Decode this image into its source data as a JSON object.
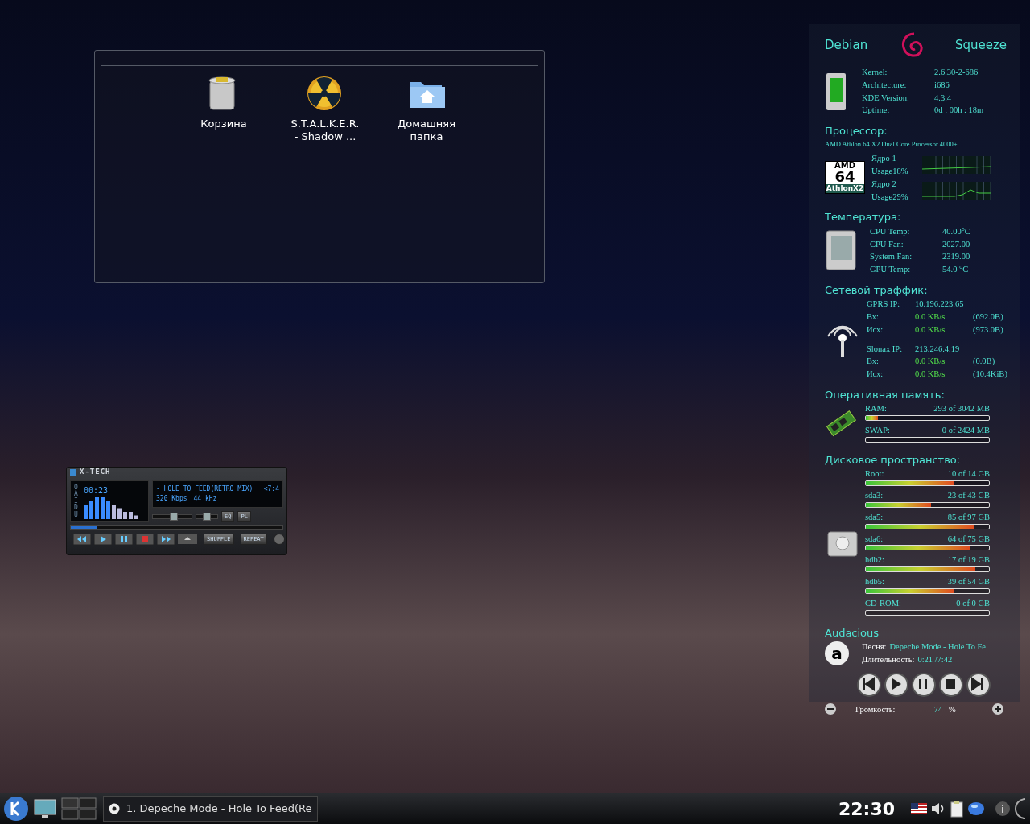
{
  "desktop": {
    "folder_view": {
      "icons": [
        {
          "label": "Корзина",
          "kind": "trash"
        },
        {
          "label": "S.T.A.L.K.E.R.\n- Shadow ...",
          "kind": "radiation"
        },
        {
          "label": "Домашняя\nпапка",
          "kind": "home"
        }
      ]
    }
  },
  "player": {
    "title": "X-TECH",
    "side_label": "OAIDU",
    "time": "00:23",
    "track": "- HOLE TO FEED(RETRO MIX)",
    "track_tail": "<7:4",
    "bitrate": "320 Kbps",
    "samplerate": "44 kHz",
    "volume": {
      "level": 0.55
    },
    "balance": {
      "level": 0.5
    },
    "seek": {
      "level": 0.12
    },
    "toggles": [
      "EQ",
      "PL"
    ],
    "modes": [
      "SHUFFLE",
      "REPEAT"
    ]
  },
  "conky": {
    "header": {
      "left": "Debian",
      "right": "Squeeze"
    },
    "system": [
      {
        "label": "Kernel:",
        "value": "2.6.30-2-686"
      },
      {
        "label": "Architecture:",
        "value": "i686"
      },
      {
        "label": "KDE Version:",
        "value": "4.3.4"
      },
      {
        "label": "Uptime:",
        "value": "0d : 00h : 18m"
      }
    ],
    "cpu": {
      "heading": "Процессор:",
      "model": "AMD Athlon 64 X2 Dual Core Processor 4000+",
      "logo": {
        "top": "AMD",
        "middle": "64",
        "bottom": "AthlonX2"
      },
      "cores": [
        {
          "name": "Ядро 1",
          "usage": "Usage18%"
        },
        {
          "name": "Ядро 2",
          "usage": "Usage29%"
        }
      ]
    },
    "temperature": {
      "heading": "Температура:",
      "rows": [
        {
          "label": "CPU Temp:",
          "value": "40.00°C"
        },
        {
          "label": "CPU Fan:",
          "value": "2027.00"
        },
        {
          "label": "System Fan:",
          "value": "2319.00"
        },
        {
          "label": "GPU Temp:",
          "value": "54.0 °C"
        }
      ]
    },
    "network": {
      "heading": "Сетевой траффик:",
      "interfaces": [
        {
          "ip_label": "GPRS IP:",
          "ip": "10.196.223.65",
          "rows": [
            {
              "label": "Вх:",
              "rate": "0.0 KB/s",
              "total": "(692.0B)"
            },
            {
              "label": "Исх:",
              "rate": "0.0 KB/s",
              "total": "(973.0B)"
            }
          ]
        },
        {
          "ip_label": "Slonax IP:",
          "ip": "213.246.4.19",
          "rows": [
            {
              "label": "Вх:",
              "rate": "0.0 KB/s",
              "total": "(0.0B)"
            },
            {
              "label": "Исх:",
              "rate": "0.0 KB/s",
              "total": "(10.4KiB)"
            }
          ]
        }
      ]
    },
    "memory": {
      "heading": "Оперативная память:",
      "rows": [
        {
          "label": "RAM:",
          "value": "293 of 3042 MB",
          "level": 0.1
        },
        {
          "label": "SWAP:",
          "value": "0 of 2424 MB",
          "level": 0
        }
      ]
    },
    "disks": {
      "heading": "Дисковое пространство:",
      "rows": [
        {
          "label": "Root:",
          "value": "10 of 14 GB",
          "level": 0.71
        },
        {
          "label": "sda3:",
          "value": "23 of 43 GB",
          "level": 0.53
        },
        {
          "label": "sda5:",
          "value": "85 of 97 GB",
          "level": 0.88
        },
        {
          "label": "sda6:",
          "value": "64 of 75 GB",
          "level": 0.85
        },
        {
          "label": "hdb2:",
          "value": "17 of 19 GB",
          "level": 0.89
        },
        {
          "label": "hdb5:",
          "value": "39 of 54 GB",
          "level": 0.72
        },
        {
          "label": "CD-ROM:",
          "value": "0 of 0 GB",
          "level": 0
        }
      ]
    },
    "audacious": {
      "heading": "Audacious",
      "logo": "a",
      "song_label": "Песня:",
      "song": "Depeche Mode - Hole To Fe",
      "duration_label": "Длительность:",
      "duration": "0:21 /7:42",
      "volume_label": "Громкость:",
      "volume": "74",
      "unit": "%"
    }
  },
  "taskbar": {
    "task": "1. Depeche Mode - Hole To Feed(Re",
    "clock": "22:30"
  }
}
